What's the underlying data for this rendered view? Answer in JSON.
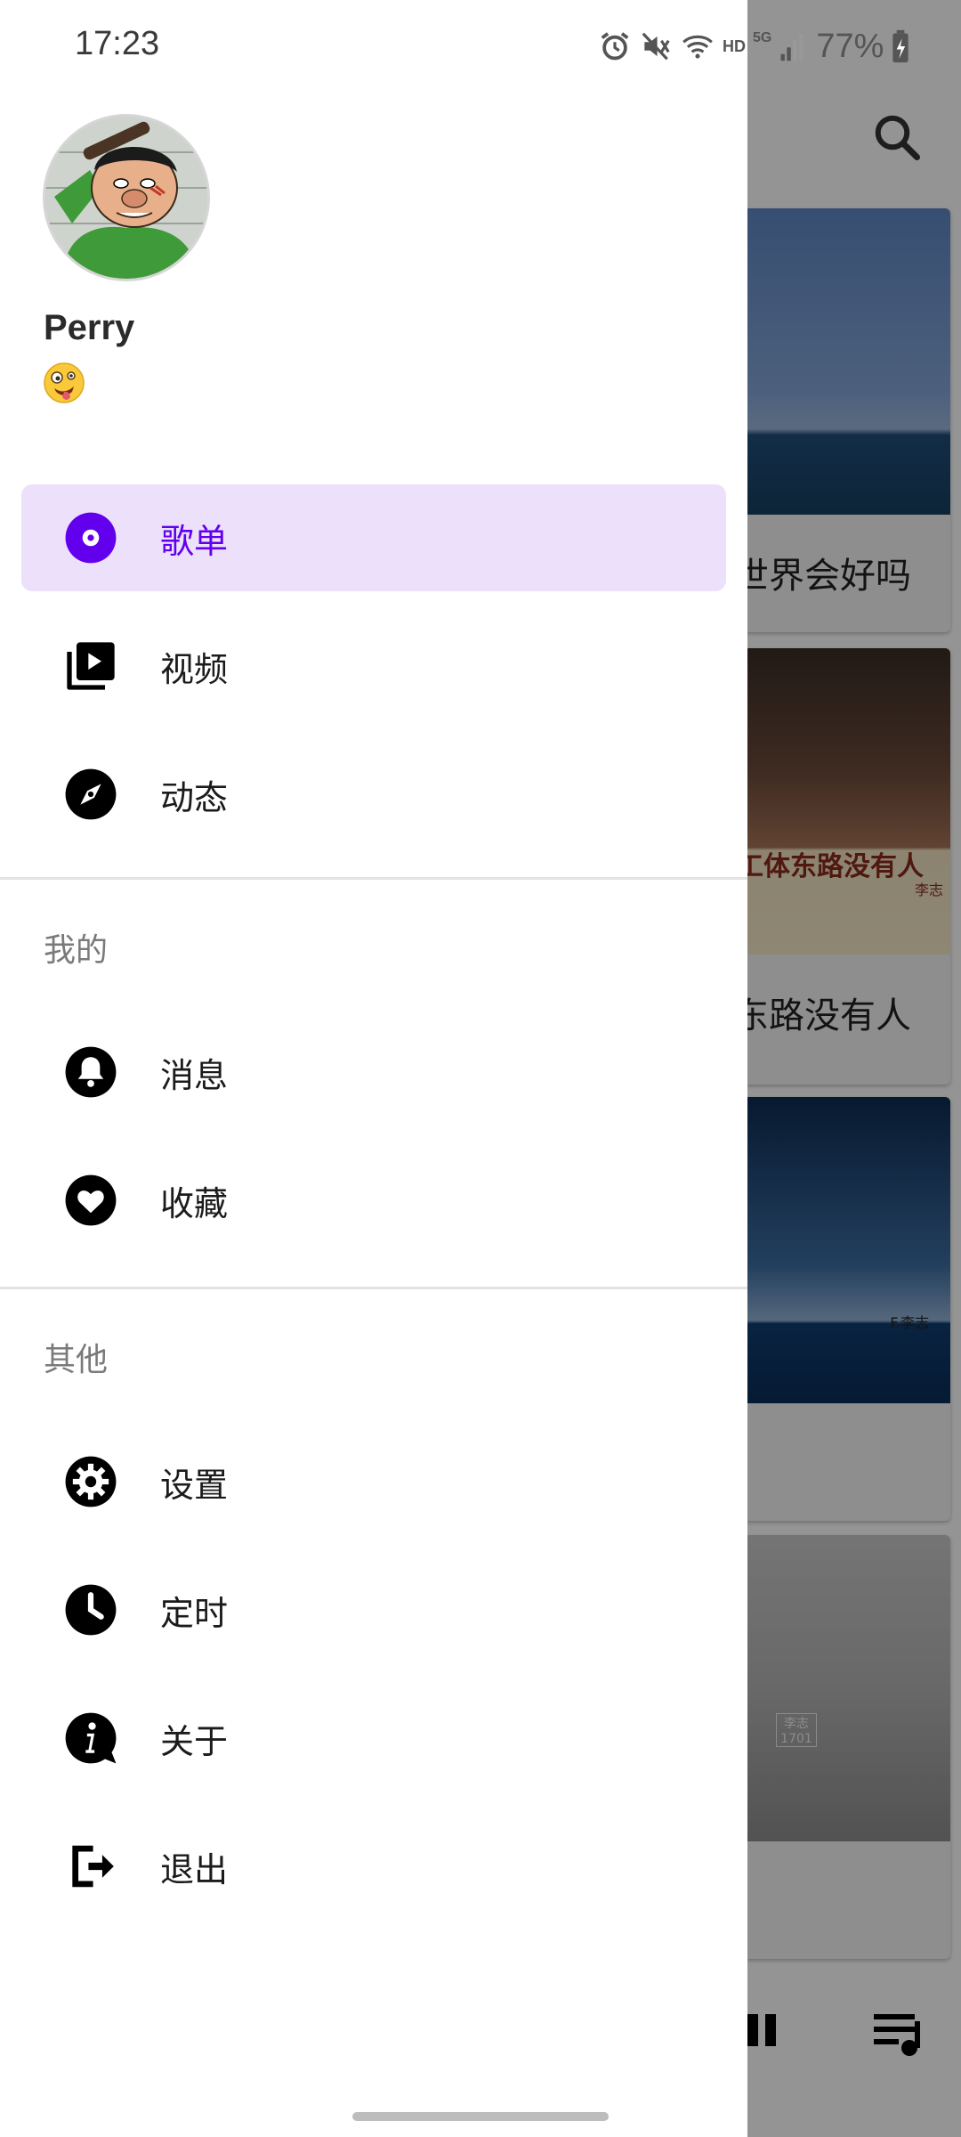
{
  "status_bar": {
    "time": "17:23",
    "battery": "77%",
    "network_label": "HD",
    "signal_label": "5G",
    "icons": [
      "alarm-icon",
      "mute-icon",
      "wifi-icon",
      "signal-icon",
      "battery-charging-icon"
    ]
  },
  "profile": {
    "name": "Perry",
    "emoji": "zany-face-emoji"
  },
  "nav": {
    "primary": [
      {
        "label": "歌单",
        "icon": "disc-icon",
        "active": true
      },
      {
        "label": "视频",
        "icon": "video-library-icon",
        "active": false
      },
      {
        "label": "动态",
        "icon": "compass-icon",
        "active": false
      }
    ],
    "section_mine": "我的",
    "mine": [
      {
        "label": "消息",
        "icon": "bell-icon"
      },
      {
        "label": "收藏",
        "icon": "heart-icon"
      }
    ],
    "section_other": "其他",
    "other": [
      {
        "label": "设置",
        "icon": "settings-icon"
      },
      {
        "label": "定时",
        "icon": "clock-icon"
      },
      {
        "label": "关于",
        "icon": "info-icon"
      },
      {
        "label": "退出",
        "icon": "logout-icon"
      }
    ]
  },
  "background": {
    "cards": [
      {
        "title": "世界会好吗"
      },
      {
        "title": "东路没有人",
        "image_text": "工体东路没有人",
        "image_sub": "李志"
      },
      {
        "title": "",
        "image_text": "F.李志"
      },
      {
        "title": "",
        "image_text": "李志 1701"
      }
    ]
  },
  "colors": {
    "accent": "#6200ee",
    "active_bg": "#ece0fb",
    "scrim": "rgba(0,0,0,0.42)"
  }
}
